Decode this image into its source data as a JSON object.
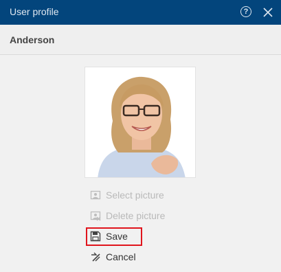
{
  "window": {
    "title": "User profile",
    "help_icon": "help-circle-icon",
    "close_icon": "close-icon"
  },
  "header": {
    "user_name": "Anderson"
  },
  "profile_picture": {
    "icon": "user-photo",
    "present": true
  },
  "actions": {
    "select_picture": {
      "label": "Select picture",
      "icon": "image-icon",
      "enabled": false
    },
    "delete_picture": {
      "label": "Delete picture",
      "icon": "image-delete-icon",
      "enabled": false
    },
    "save": {
      "label": "Save",
      "icon": "floppy-disk-icon",
      "enabled": true,
      "highlighted": true
    },
    "cancel": {
      "label": "Cancel",
      "icon": "cancel-icon",
      "enabled": true
    }
  },
  "colors": {
    "titlebar": "#03457c",
    "highlight": "#e0141c"
  }
}
